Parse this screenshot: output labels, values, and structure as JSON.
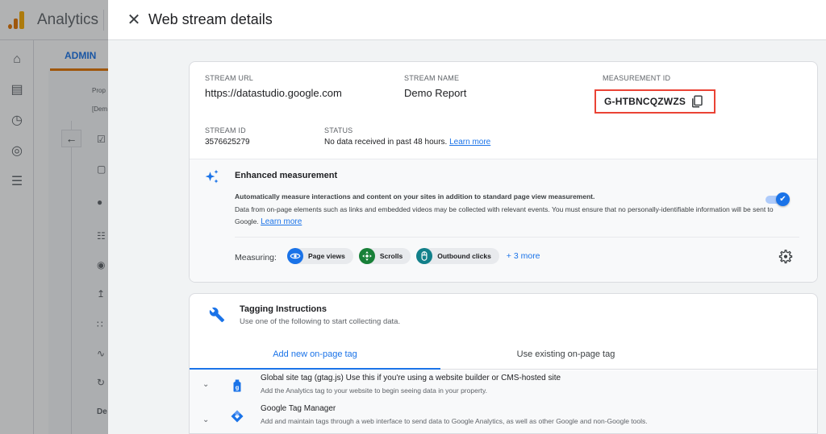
{
  "background_app": {
    "app_title": "Analytics",
    "admin_tab": "ADMIN",
    "property_label": "Prop",
    "property_value": "[Dem",
    "truncated_item": "De"
  },
  "dialog": {
    "title": "Web stream details",
    "close_icon": "close-icon"
  },
  "stream": {
    "url_label": "STREAM URL",
    "url_value": "https://datastudio.google.com",
    "name_label": "STREAM NAME",
    "name_value": "Demo Report",
    "measurement_id_label": "MEASUREMENT ID",
    "measurement_id_value": "G-HTBNCQZWZS",
    "id_label": "STREAM ID",
    "id_value": "3576625279",
    "status_label": "STATUS",
    "status_value": "No data received in past 48 hours.",
    "status_link": "Learn more"
  },
  "enhanced_measurement": {
    "title": "Enhanced measurement",
    "description_bold": "Automatically measure interactions and content on your sites in addition to standard page view measurement.",
    "description": "Data from on-page elements such as links and embedded videos may be collected with relevant events. You must ensure that no personally-identifiable information will be sent to Google.",
    "learn_more": "Learn more",
    "enabled": true,
    "measuring_label": "Measuring:",
    "chips": [
      {
        "label": "Page views",
        "icon": "eye-icon",
        "color": "#1a73e8"
      },
      {
        "label": "Scrolls",
        "icon": "scroll-arrows-icon",
        "color": "#188038"
      },
      {
        "label": "Outbound clicks",
        "icon": "mouse-icon",
        "color": "#12808a"
      }
    ],
    "more_link": "+ 3 more"
  },
  "tagging": {
    "title": "Tagging Instructions",
    "subtitle": "Use one of the following to start collecting data.",
    "tabs": [
      {
        "label": "Add new on-page tag",
        "active": true
      },
      {
        "label": "Use existing on-page tag",
        "active": false
      }
    ],
    "items": [
      {
        "title_bold": "Global site tag (gtag.js)",
        "title_rest": " Use this if you're using a website builder or CMS-hosted site",
        "description": "Add the Analytics tag to your website to begin seeing data in your property."
      },
      {
        "title_bold": "Google Tag Manager",
        "title_rest": "",
        "description": "Add and maintain tags through a web interface to send data to Google Analytics, as well as other Google and non-Google tools."
      }
    ]
  },
  "colors": {
    "accent": "#1a73e8",
    "highlight_box": "#ea4335",
    "admin_tab_underline": "#e37400"
  }
}
